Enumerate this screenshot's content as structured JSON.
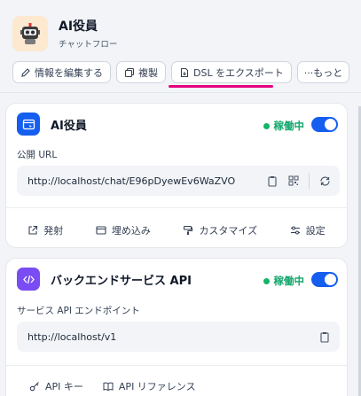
{
  "app": {
    "title": "AI役員",
    "subtitle": "チャットフロー"
  },
  "toolbar": {
    "edit_info": "情報を編集する",
    "duplicate": "複製",
    "export_dsl": "DSL をエクスポート",
    "more": "···もっと"
  },
  "webapp": {
    "title": "AI役員",
    "status": "稼働中",
    "url_label": "公開 URL",
    "url": "http://localhost/chat/E96pDyewEv6WaZVO",
    "actions": [
      "発射",
      "埋め込み",
      "カスタマイズ",
      "設定"
    ]
  },
  "api": {
    "title": "バックエンドサービス API",
    "status": "稼働中",
    "endpoint_label": "サービス API エンドポイント",
    "endpoint": "http://localhost/v1",
    "actions": [
      "API キー",
      "API リファレンス"
    ]
  },
  "colors": {
    "accent": "#155eef",
    "status": "#17b26a",
    "highlight": "#e5007e",
    "api_icon": "#7a4cf4"
  }
}
